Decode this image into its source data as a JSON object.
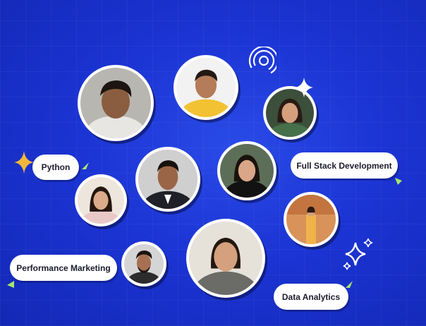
{
  "tags": {
    "python": "Python",
    "full_stack": "Full Stack Development",
    "performance_marketing": "Performance Marketing",
    "data_analytics": "Data Analytics"
  },
  "colors": {
    "background": "#1b34d4",
    "pill_bg": "#ffffff",
    "pill_text": "#1b1b2e",
    "sparkle_gold": "#f4b63b",
    "cursor_green": "#a8e66a"
  }
}
